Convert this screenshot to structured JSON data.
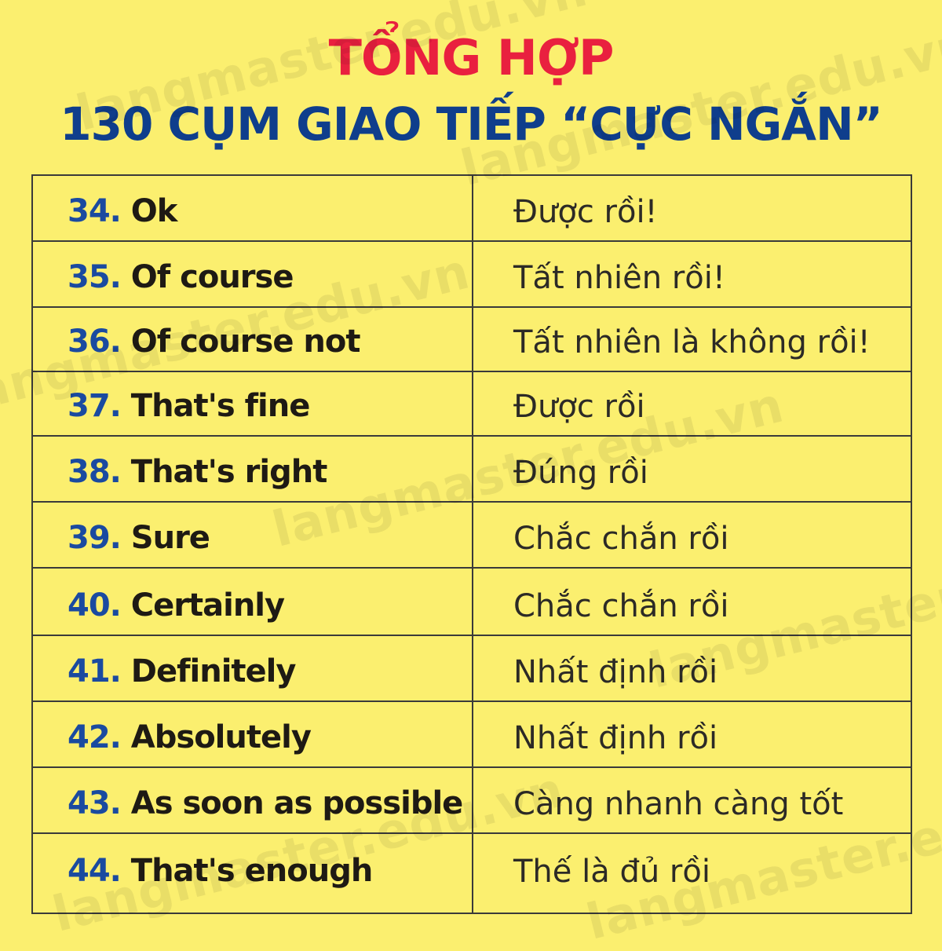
{
  "header": {
    "line1": "TỔNG HỢP",
    "line2": "130 CỤM GIAO TIẾP “CỰC NGẮN”"
  },
  "watermark": "langmaster.edu.vn",
  "phrases": [
    {
      "num": "34.",
      "en": "Ok",
      "vi": "Được rồi!"
    },
    {
      "num": "35.",
      "en": "Of course",
      "vi": "Tất nhiên rồi!"
    },
    {
      "num": "36.",
      "en": "Of course not",
      "vi": "Tất nhiên là không rồi!"
    },
    {
      "num": "37.",
      "en": "That's fine",
      "vi": "Được rồi"
    },
    {
      "num": "38.",
      "en": "That's right",
      "vi": "Đúng rồi"
    },
    {
      "num": "39.",
      "en": "Sure",
      "vi": "Chắc chắn rồi"
    },
    {
      "num": "40.",
      "en": "Certainly",
      "vi": "Chắc chắn rồi"
    },
    {
      "num": "41.",
      "en": "Definitely",
      "vi": "Nhất định rồi"
    },
    {
      "num": "42.",
      "en": "Absolutely",
      "vi": "Nhất định rồi"
    },
    {
      "num": "43.",
      "en": "As soon as possible",
      "vi": "Càng nhanh càng tốt"
    },
    {
      "num": "44.",
      "en": "That's enough",
      "vi": "Thế là đủ rồi"
    }
  ],
  "colors": {
    "background": "#fbef6f",
    "title_red": "#e9203f",
    "title_blue": "#0f3e8c",
    "number_blue": "#1a4aa0",
    "border": "#3a3a3a"
  }
}
